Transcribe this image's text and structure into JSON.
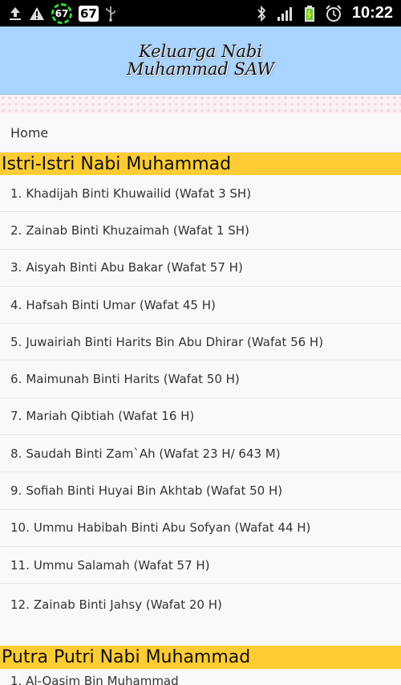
{
  "statusbar": {
    "icons_left": [
      "upload-icon",
      "warning-icon",
      "battery-circle-icon",
      "badge-icon",
      "usb-icon"
    ],
    "circle_value": "67",
    "box_value": "67",
    "icons_right": [
      "bluetooth-icon",
      "signal-icon",
      "battery-icon",
      "alarm-icon"
    ],
    "time": "10:22"
  },
  "header": {
    "title_line1": "Keluarga Nabi",
    "title_line2": "Muhammad SAW"
  },
  "nav": {
    "home": "Home"
  },
  "section1": {
    "title": "Istri-Istri Nabi Muhammad",
    "items": [
      {
        "num": "1.",
        "text": "Khadijah Binti Khuwailid (Wafat 3 SH)"
      },
      {
        "num": "2.",
        "text": "Zainab Binti Khuzaimah (Wafat 1 SH)"
      },
      {
        "num": "3.",
        "text": "Aisyah Binti Abu Bakar (Wafat 57 H)"
      },
      {
        "num": "4.",
        "text": "Hafsah Binti Umar (Wafat 45 H)"
      },
      {
        "num": "5.",
        "text": "Juwairiah Binti Harits Bin Abu Dhirar (Wafat 56 H)"
      },
      {
        "num": "6.",
        "text": "Maimunah Binti Harits (Wafat 50 H)"
      },
      {
        "num": "7.",
        "text": "Mariah Qibtiah (Wafat 16 H)"
      },
      {
        "num": "8.",
        "text": "Saudah Binti Zam`Ah (Wafat 23 H/ 643 M)"
      },
      {
        "num": "9.",
        "text": "Sofiah Binti Huyai Bin Akhtab (Wafat 50 H)"
      },
      {
        "num": "10.",
        "text": "Ummu Habibah Binti Abu Sofyan (Wafat 44 H)"
      },
      {
        "num": "11.",
        "text": "Ummu Salamah (Wafat 57 H)"
      },
      {
        "num": "12.",
        "text": "Zainab Binti Jahsy (Wafat 20 H)"
      }
    ]
  },
  "section2": {
    "title": "Putra Putri Nabi Muhammad",
    "peek_item": "1. Al-Qasim Bin Muhammad"
  }
}
